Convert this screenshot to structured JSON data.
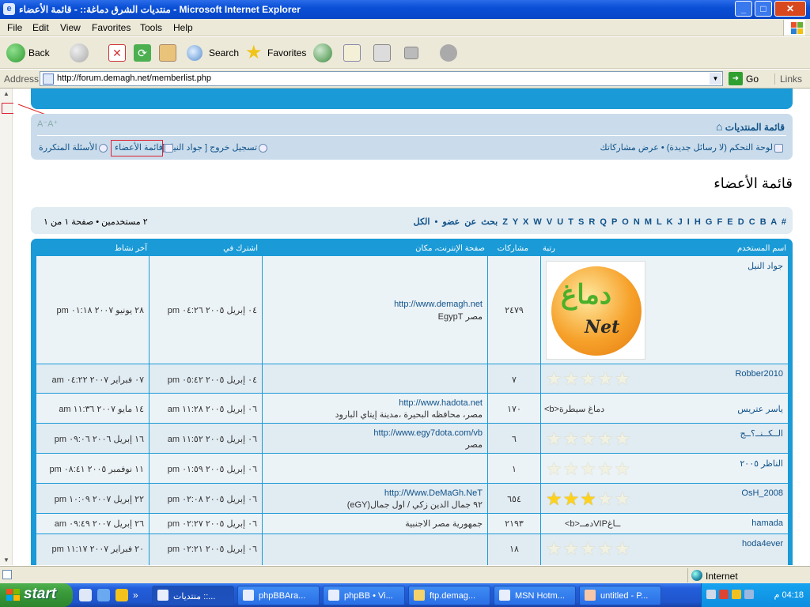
{
  "window": {
    "title": "منتديات الشرق دماغة:: - قائمة الأعضاء - Microsoft Internet Explorer"
  },
  "menu": [
    "File",
    "Edit",
    "View",
    "Favorites",
    "Tools",
    "Help"
  ],
  "toolbar": {
    "back": "Back",
    "search": "Search",
    "favorites": "Favorites"
  },
  "address": {
    "label": "Address",
    "url": "http://forum.demagh.net/memberlist.php",
    "go": "Go",
    "links": "Links"
  },
  "nav": {
    "forum_index": "قائمة المنتديات",
    "font_size": "A⁻A⁺",
    "control_panel": "لوحة التحكم",
    "no_new_msgs": "(لا رسائل جديدة)",
    "view_posts": "• عرض مشاركاتك",
    "logout": "تسجيل خروج [ جواد النيل ]",
    "memberlist": "قائمة الأعضاء",
    "faq": "الأسئلة المتكررة"
  },
  "page_title": "قائمة الأعضاء",
  "letters": "بحث عن عضو • الكل  Z  Y  X  W  V  U  T  S  R  Q  P  O  N  M  L  K  J  I  H  G  F  E  D  C  B  A  #",
  "count_text": "٢ مستخدمين • صفحة ١ من ١",
  "table": {
    "headers": {
      "username": "اسم المستخدم",
      "rank": "رتبة",
      "posts": "مشاركات",
      "website": "صفحة الإنترنت، مكان",
      "joined": "اشترك في",
      "last_active": "آخر نشاط"
    },
    "rows": [
      {
        "username": "جواد النيل",
        "website": "http://www.demagh.net",
        "location": "مصر EgypT",
        "posts": "٢٤٧٩",
        "joined": "٠٤ إبريل ٢٠٠٥ ٠٤:٢٦ pm",
        "last": "٢٨ يونيو ٢٠٠٧ ٠١:١٨ pm",
        "logo": "دماغ",
        "logo_sub": "Net"
      },
      {
        "username": "Robber2010",
        "website": "",
        "location": "",
        "posts": "٧",
        "joined": "٠٤ إبريل ٢٠٠٥ ٠٥:٤٢ pm",
        "last": "٠٧ فبراير ٢٠٠٧ ٠٤:٢٢ am",
        "stars": 0
      },
      {
        "username": "ياسر عتريس",
        "rank": "<b>دماغ سيطرة",
        "website": "http://www.hadota.net",
        "location": "مصر، محافظه البحيرة ،مدينة إيتاي البارود",
        "posts": "١٧٠",
        "joined": "٠٦ إبريل ٢٠٠٥ ١١:٢٨ am",
        "last": "١٤ مايو ٢٠٠٧ ١١:٣٦ am"
      },
      {
        "username": "الــكــنــ؟ــج",
        "website": "http://www.egy7dota.com/vb",
        "location": "مصر",
        "posts": "٦",
        "joined": "٠٦ إبريل ٢٠٠٥ ١١:٥٢ am",
        "last": "١٦ إبريل ٢٠٠٦ ٠٩:٠٦ pm",
        "stars": 0
      },
      {
        "username": "الناظر ٢٠٠٥",
        "website": "",
        "location": "",
        "posts": "١",
        "joined": "٠٦ إبريل ٢٠٠٥ ٠١:٥٩ pm",
        "last": "١١ نوفمبر ٢٠٠٥ ٠٨:٤١ pm",
        "stars": 0
      },
      {
        "username": "OsH_2008",
        "website": "http://Www.DeMaGh.NeT",
        "location": "٩٢ جمال الدين زكي / اول جمال(eGY)",
        "posts": "٦٥٤",
        "joined": "٠٦ إبريل ٢٠٠٥ ٠٢:٠٨ pm",
        "last": "٢٢ إبريل ٢٠٠٧ ١٠:٠٩ pm",
        "stars": 3
      },
      {
        "username": "hamada",
        "rank": "<b>دمــVIPــاغ",
        "website": "",
        "location": "جمهورية مصر الاجنبية",
        "posts": "٢١٩٣",
        "joined": "٠٦ إبريل ٢٠٠٥ ٠٢:٢٧ pm",
        "last": "٢٦ إبريل ٢٠٠٧ ٠٩:٤٩ am"
      },
      {
        "username": "hoda4ever",
        "website": "",
        "location": "",
        "posts": "١٨",
        "joined": "٠٦ إبريل ٢٠٠٥ ٠٢:٢١ pm",
        "last": "٢٠ فبراير ٢٠٠٧ ١١:١٧ pm",
        "stars": 0
      }
    ]
  },
  "status": {
    "zone": "Internet"
  },
  "taskbar": {
    "start": "start",
    "tasks": [
      "منتديات ::...",
      "phpBBAra...",
      "phpBB • Vi...",
      "ftp.demag...",
      "MSN Hotm...",
      "untitled - P..."
    ],
    "clock": "04:18 م"
  }
}
